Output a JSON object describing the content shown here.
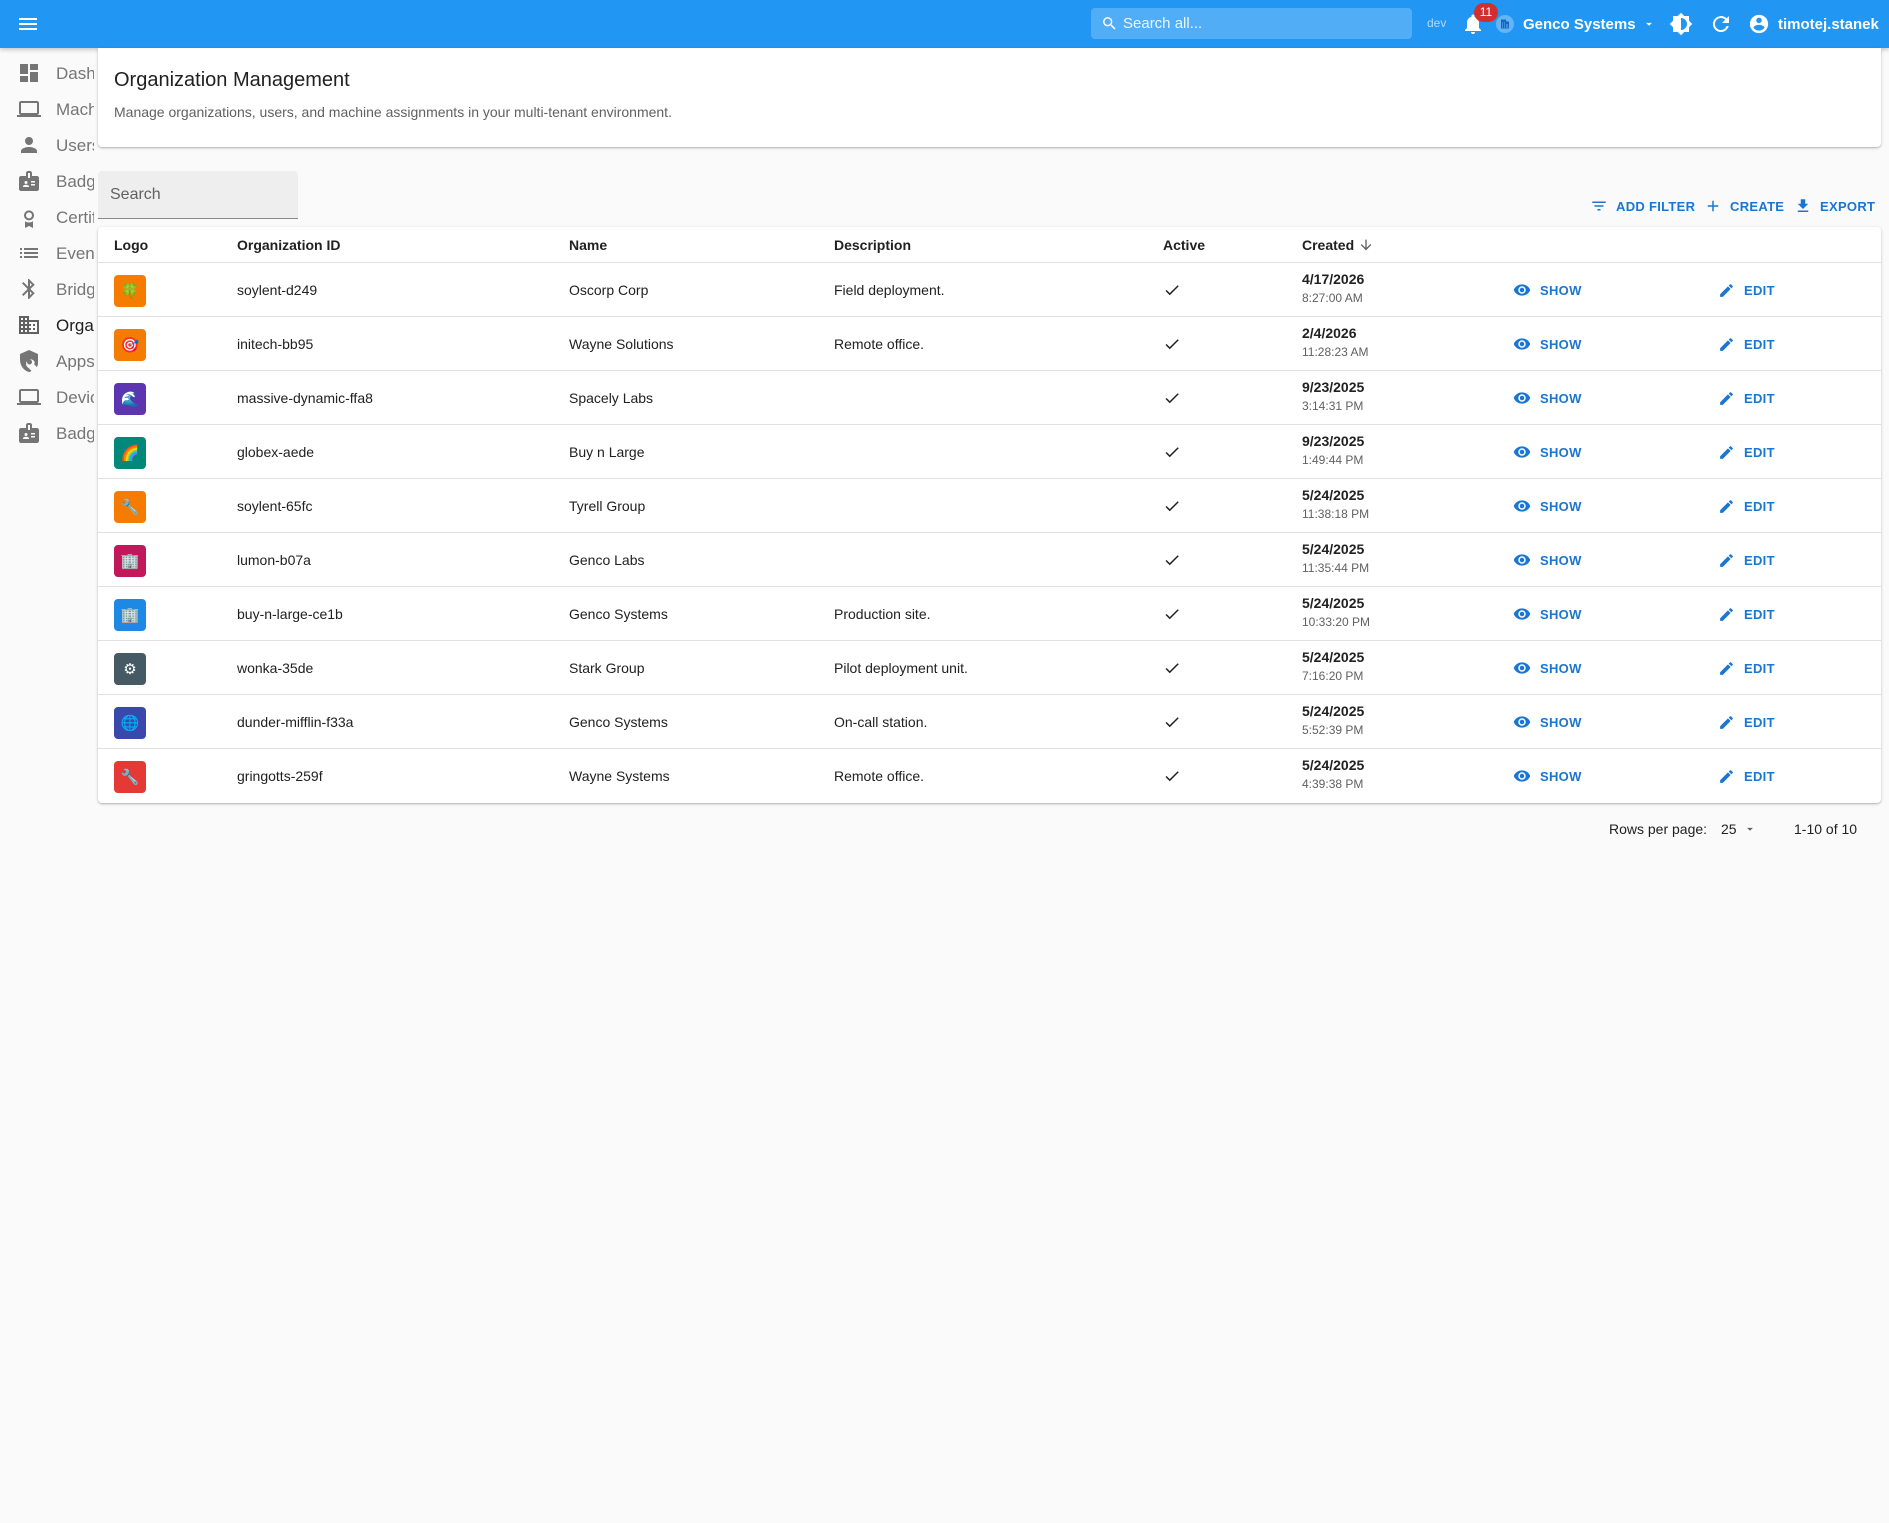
{
  "appbar": {
    "search_placeholder": "Search all...",
    "env_label": "dev",
    "notification_count": "11",
    "organization": "Genco Systems",
    "username": "timotej.stanek",
    "color": "#2196f3"
  },
  "sidebar": {
    "items": [
      {
        "label": "Dashboard",
        "icon": "dashboard-icon"
      },
      {
        "label": "Machines",
        "icon": "laptop-icon"
      },
      {
        "label": "Users",
        "icon": "person-icon"
      },
      {
        "label": "Badges",
        "icon": "badge-icon"
      },
      {
        "label": "Certificates",
        "icon": "certificate-icon"
      },
      {
        "label": "Events",
        "icon": "list-icon"
      },
      {
        "label": "Bridges",
        "icon": "bluetooth-icon"
      },
      {
        "label": "Organizations",
        "icon": "business-icon"
      },
      {
        "label": "Apps",
        "icon": "policy-icon"
      },
      {
        "label": "Devices",
        "icon": "laptop-icon"
      },
      {
        "label": "Badges",
        "icon": "badge-icon"
      }
    ]
  },
  "header": {
    "title": "Organization Management",
    "subtitle": "Manage organizations, users, and machine assignments in your multi-tenant environment."
  },
  "toolbar": {
    "search_placeholder": "Search",
    "add_filter": "ADD FILTER",
    "create": "CREATE",
    "export": "EXPORT"
  },
  "table": {
    "columns": {
      "logo": "Logo",
      "id": "Organization ID",
      "name": "Name",
      "description": "Description",
      "active": "Active",
      "created": "Created"
    },
    "show_label": "SHOW",
    "edit_label": "EDIT",
    "rows": [
      {
        "logo": "🍀",
        "logo_color": "#f57c00",
        "id": "soylent-d249",
        "name": "Oscorp Corp",
        "description": "Field deployment.",
        "active": true,
        "date": "4/17/2026",
        "time": "8:27:00 AM"
      },
      {
        "logo": "🎯",
        "logo_color": "#f57c00",
        "id": "initech-bb95",
        "name": "Wayne Solutions",
        "description": "Remote office.",
        "active": true,
        "date": "2/4/2026",
        "time": "11:28:23 AM"
      },
      {
        "logo": "🌊",
        "logo_color": "#5e35b1",
        "id": "massive-dynamic-ffa8",
        "name": "Spacely Labs",
        "description": "",
        "active": true,
        "date": "9/23/2025",
        "time": "3:14:31 PM"
      },
      {
        "logo": "🌈",
        "logo_color": "#00897b",
        "id": "globex-aede",
        "name": "Buy n Large",
        "description": "",
        "active": true,
        "date": "9/23/2025",
        "time": "1:49:44 PM"
      },
      {
        "logo": "🔧",
        "logo_color": "#f57c00",
        "id": "soylent-65fc",
        "name": "Tyrell Group",
        "description": "",
        "active": true,
        "date": "5/24/2025",
        "time": "11:38:18 PM"
      },
      {
        "logo": "🏢",
        "logo_color": "#c2185b",
        "id": "lumon-b07a",
        "name": "Genco Labs",
        "description": "",
        "active": true,
        "date": "5/24/2025",
        "time": "11:35:44 PM"
      },
      {
        "logo": "🏢",
        "logo_color": "#1e88e5",
        "id": "buy-n-large-ce1b",
        "name": "Genco Systems",
        "description": "Production site.",
        "active": true,
        "date": "5/24/2025",
        "time": "10:33:20 PM"
      },
      {
        "logo": "⚙",
        "logo_color": "#455a64",
        "id": "wonka-35de",
        "name": "Stark Group",
        "description": "Pilot deployment unit.",
        "active": true,
        "date": "5/24/2025",
        "time": "7:16:20 PM"
      },
      {
        "logo": "🌐",
        "logo_color": "#3949ab",
        "id": "dunder-mifflin-f33a",
        "name": "Genco Systems",
        "description": "On-call station.",
        "active": true,
        "date": "5/24/2025",
        "time": "5:52:39 PM"
      },
      {
        "logo": "🔧",
        "logo_color": "#e53935",
        "id": "gringotts-259f",
        "name": "Wayne Systems",
        "description": "Remote office.",
        "active": true,
        "date": "5/24/2025",
        "time": "4:39:38 PM"
      }
    ]
  },
  "pagination": {
    "rows_per_page_label": "Rows per page:",
    "rows_per_page": "25",
    "range": "1-10 of 10"
  }
}
